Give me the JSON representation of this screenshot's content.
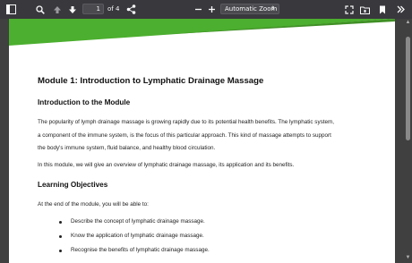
{
  "toolbar": {
    "current_page": "1",
    "page_count_label": "of 4",
    "zoom_value": "Automatic Zoom",
    "icons": [
      "sidebar-toggle-icon",
      "search-icon",
      "previous-page-icon",
      "next-page-icon",
      "share-icon",
      "zoom-out-icon",
      "zoom-in-icon",
      "fullscreen-icon",
      "open-file-icon",
      "bookmark-icon",
      "more-tools-icon"
    ]
  },
  "document": {
    "module_title": "Module 1: Introduction to Lymphatic Drainage Massage",
    "intro_heading": "Introduction to the Module",
    "intro_lines": [
      "The popularity of lymph drainage massage is growing rapidly due to its potential health benefits. The lymphatic system,",
      "a component of the immune system, is the focus of this particular approach. This kind of massage attempts to support",
      "the body's immune system, fluid balance, and healthy blood circulation."
    ],
    "overview": "In this module, we will give an overview of lymphatic drainage massage, its application and its benefits.",
    "objectives_heading": "Learning Objectives",
    "objectives_intro": "At the end of the module, you will be able to:",
    "objectives": [
      "Describe the concept of lymphatic drainage massage.",
      "Know the application of lymphatic drainage massage.",
      "Recognise the benefits of lymphatic drainage massage."
    ]
  },
  "colors": {
    "toolbar": "#38383d",
    "banner_green": "#4caf2f",
    "viewer_bg": "#404040"
  }
}
